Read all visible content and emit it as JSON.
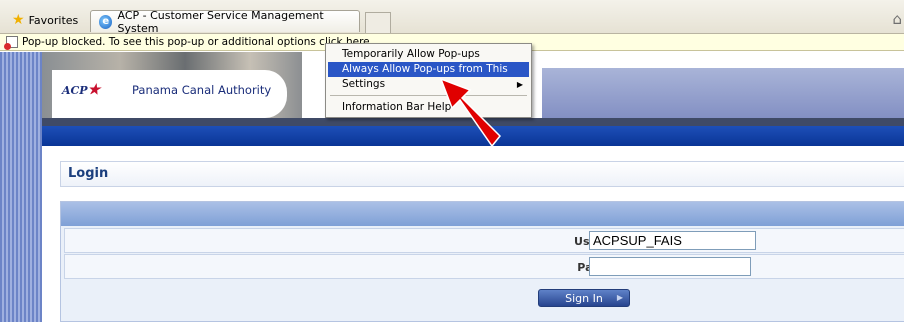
{
  "favorites_bar": {
    "favorites_label": "Favorites",
    "tab_title": "ACP - Customer Service Management System"
  },
  "info_bar": {
    "message": "Pop-up blocked. To see this pop-up or additional options click here..."
  },
  "context_menu": {
    "items": [
      {
        "label": "Temporarily Allow Pop-ups"
      },
      {
        "label": "Always Allow Pop-ups from This Site..."
      },
      {
        "label": "Settings"
      },
      {
        "label": "Information Bar Help"
      }
    ],
    "highlighted_item": "Always Allow Pop-ups from This Site...",
    "submenu_glyph": "▶"
  },
  "header": {
    "logo_text": "ACP",
    "logo_star": "★",
    "org_name": "Panama Canal Authority"
  },
  "login": {
    "title": "Login",
    "username_label": "Username:",
    "username_value": "ACPSUP_FAIS",
    "password_label": "Password:",
    "password_value": "",
    "signin_label": "Sign In",
    "signin_glyph": "▶"
  },
  "icons": {
    "favorites": "star-icon",
    "tab": "internet-explorer-icon",
    "home": "home-icon",
    "blocked": "popup-blocked-icon",
    "annotation": "red-arrow-icon"
  },
  "colors": {
    "menu_highlight": "#2a56c6",
    "navbar": "#0a3596",
    "annotation_arrow": "#e00000",
    "info_bar": "#ffffe1"
  }
}
